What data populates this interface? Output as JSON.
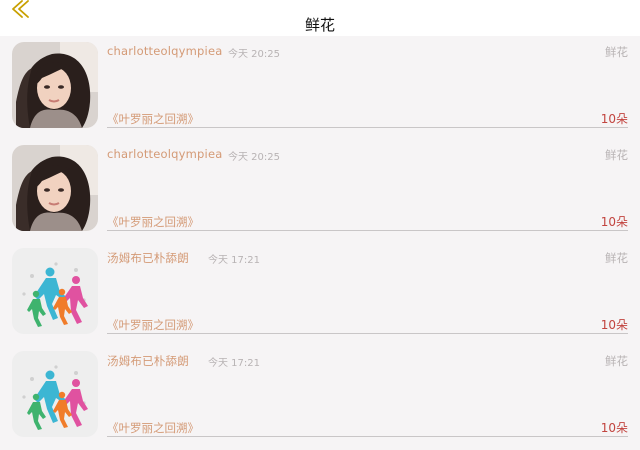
{
  "header": {
    "title": "鲜花",
    "back_icon": "chevron-left-icon",
    "accent_color": "#c8a000"
  },
  "records": [
    {
      "username": "charlotteolqympiea",
      "time": "今天 20:25",
      "type": "鲜花",
      "book": "《叶罗丽之回溯》",
      "amount": "10朵",
      "avatar": "girl-portrait-avatar"
    },
    {
      "username": "charlotteolqympiea",
      "time": "今天 20:25",
      "type": "鲜花",
      "book": "《叶罗丽之回溯》",
      "amount": "10朵",
      "avatar": "girl-portrait-avatar"
    },
    {
      "username": "汤姆布已朴舔朗",
      "time": "今天 17:21",
      "type": "鲜花",
      "book": "《叶罗丽之回溯》",
      "amount": "10朵",
      "avatar": "runners-avatar"
    },
    {
      "username": "汤姆布已朴舔朗",
      "time": "今天 17:21",
      "type": "鲜花",
      "book": "《叶罗丽之回溯》",
      "amount": "10朵",
      "avatar": "runners-avatar"
    }
  ],
  "colors": {
    "username": "#d49a76",
    "amount": "#c2443f",
    "muted": "#b8b3b4"
  }
}
